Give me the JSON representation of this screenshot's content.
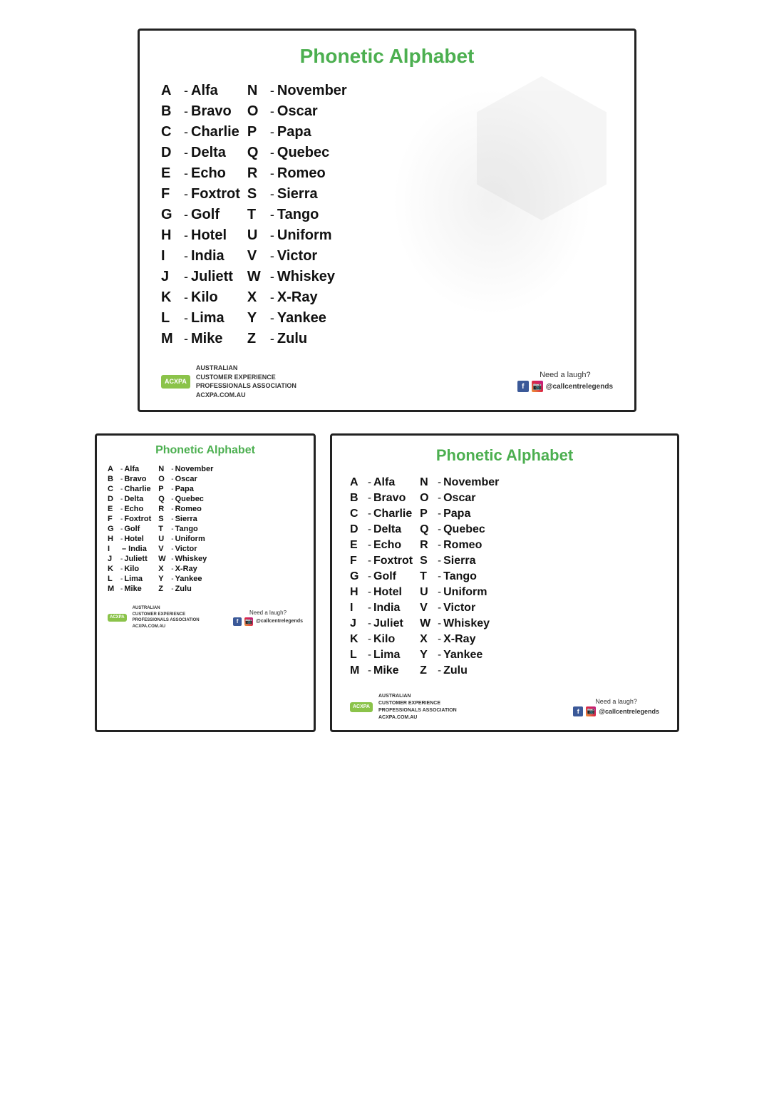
{
  "title": "Phonetic Alphabet",
  "acxpa_label": "ACXPA",
  "org_name": "AUSTRALIAN\nCUSTOMER EXPERIENCE\nPROFESSIONALS ASSOCIATION\nACXPA.COM.AU",
  "social_prompt": "Need a laugh?",
  "social_handle": "@callcentrelegends",
  "alphabet": [
    {
      "letter": "A",
      "word": "Alfa"
    },
    {
      "letter": "B",
      "word": "Bravo"
    },
    {
      "letter": "C",
      "word": "Charlie"
    },
    {
      "letter": "D",
      "word": "Delta"
    },
    {
      "letter": "E",
      "word": "Echo"
    },
    {
      "letter": "F",
      "word": "Foxtrot"
    },
    {
      "letter": "G",
      "word": "Golf"
    },
    {
      "letter": "H",
      "word": "Hotel"
    },
    {
      "letter": "I",
      "word": "India"
    },
    {
      "letter": "J",
      "word": "Juliett"
    },
    {
      "letter": "K",
      "word": "Kilo"
    },
    {
      "letter": "L",
      "word": "Lima"
    },
    {
      "letter": "M",
      "word": "Mike"
    },
    {
      "letter": "N",
      "word": "November"
    },
    {
      "letter": "O",
      "word": "Oscar"
    },
    {
      "letter": "P",
      "word": "Papa"
    },
    {
      "letter": "Q",
      "word": "Quebec"
    },
    {
      "letter": "R",
      "word": "Romeo"
    },
    {
      "letter": "S",
      "word": "Sierra"
    },
    {
      "letter": "T",
      "word": "Tango"
    },
    {
      "letter": "U",
      "word": "Uniform"
    },
    {
      "letter": "V",
      "word": "Victor"
    },
    {
      "letter": "W",
      "word": "Whiskey"
    },
    {
      "letter": "X",
      "word": "X-Ray"
    },
    {
      "letter": "Y",
      "word": "Yankee"
    },
    {
      "letter": "Z",
      "word": "Zulu"
    }
  ],
  "alphabet_small": [
    {
      "letter": "A",
      "word": "Alfa"
    },
    {
      "letter": "B",
      "word": "Bravo"
    },
    {
      "letter": "C",
      "word": "Charlie"
    },
    {
      "letter": "D",
      "word": "Delta"
    },
    {
      "letter": "E",
      "word": "Echo"
    },
    {
      "letter": "F",
      "word": "Foxtrot"
    },
    {
      "letter": "G",
      "word": "Golf"
    },
    {
      "letter": "H",
      "word": "Hotel"
    },
    {
      "letter": "I",
      "word": "– India"
    },
    {
      "letter": "J",
      "word": "Juliett"
    },
    {
      "letter": "K",
      "word": "Kilo"
    },
    {
      "letter": "L",
      "word": "Lima"
    },
    {
      "letter": "M",
      "word": "Mike"
    },
    {
      "letter": "N",
      "word": "November"
    },
    {
      "letter": "O",
      "word": "Oscar"
    },
    {
      "letter": "P",
      "word": "Papa"
    },
    {
      "letter": "Q",
      "word": "Quebec"
    },
    {
      "letter": "R",
      "word": "Romeo"
    },
    {
      "letter": "S",
      "word": "Sierra"
    },
    {
      "letter": "T",
      "word": "Tango"
    },
    {
      "letter": "U",
      "word": "Uniform"
    },
    {
      "letter": "V",
      "word": "Victor"
    },
    {
      "letter": "W",
      "word": "Whiskey"
    },
    {
      "letter": "X",
      "word": "X-Ray"
    },
    {
      "letter": "Y",
      "word": "Yankee"
    },
    {
      "letter": "Z",
      "word": "Zulu"
    }
  ],
  "alphabet_medium": [
    {
      "letter": "A",
      "word": "Alfa"
    },
    {
      "letter": "B",
      "word": "Bravo"
    },
    {
      "letter": "C",
      "word": "Charlie"
    },
    {
      "letter": "D",
      "word": "Delta"
    },
    {
      "letter": "E",
      "word": "Echo"
    },
    {
      "letter": "F",
      "word": "Foxtrot"
    },
    {
      "letter": "G",
      "word": "Golf"
    },
    {
      "letter": "H",
      "word": "Hotel"
    },
    {
      "letter": "I",
      "word": "India"
    },
    {
      "letter": "J",
      "word": "Juliet"
    },
    {
      "letter": "K",
      "word": "Kilo"
    },
    {
      "letter": "L",
      "word": "Lima"
    },
    {
      "letter": "M",
      "word": "Mike"
    },
    {
      "letter": "N",
      "word": "November"
    },
    {
      "letter": "O",
      "word": "Oscar"
    },
    {
      "letter": "P",
      "word": "Papa"
    },
    {
      "letter": "Q",
      "word": "Quebec"
    },
    {
      "letter": "R",
      "word": "Romeo"
    },
    {
      "letter": "S",
      "word": "Sierra"
    },
    {
      "letter": "T",
      "word": "Tango"
    },
    {
      "letter": "U",
      "word": "Uniform"
    },
    {
      "letter": "V",
      "word": "Victor"
    },
    {
      "letter": "W",
      "word": "Whiskey"
    },
    {
      "letter": "X",
      "word": "X-Ray"
    },
    {
      "letter": "Y",
      "word": "Yankee"
    },
    {
      "letter": "Z",
      "word": "Zulu"
    }
  ],
  "colors": {
    "title_green": "#4CAF50",
    "border": "#222222",
    "text": "#111111"
  }
}
